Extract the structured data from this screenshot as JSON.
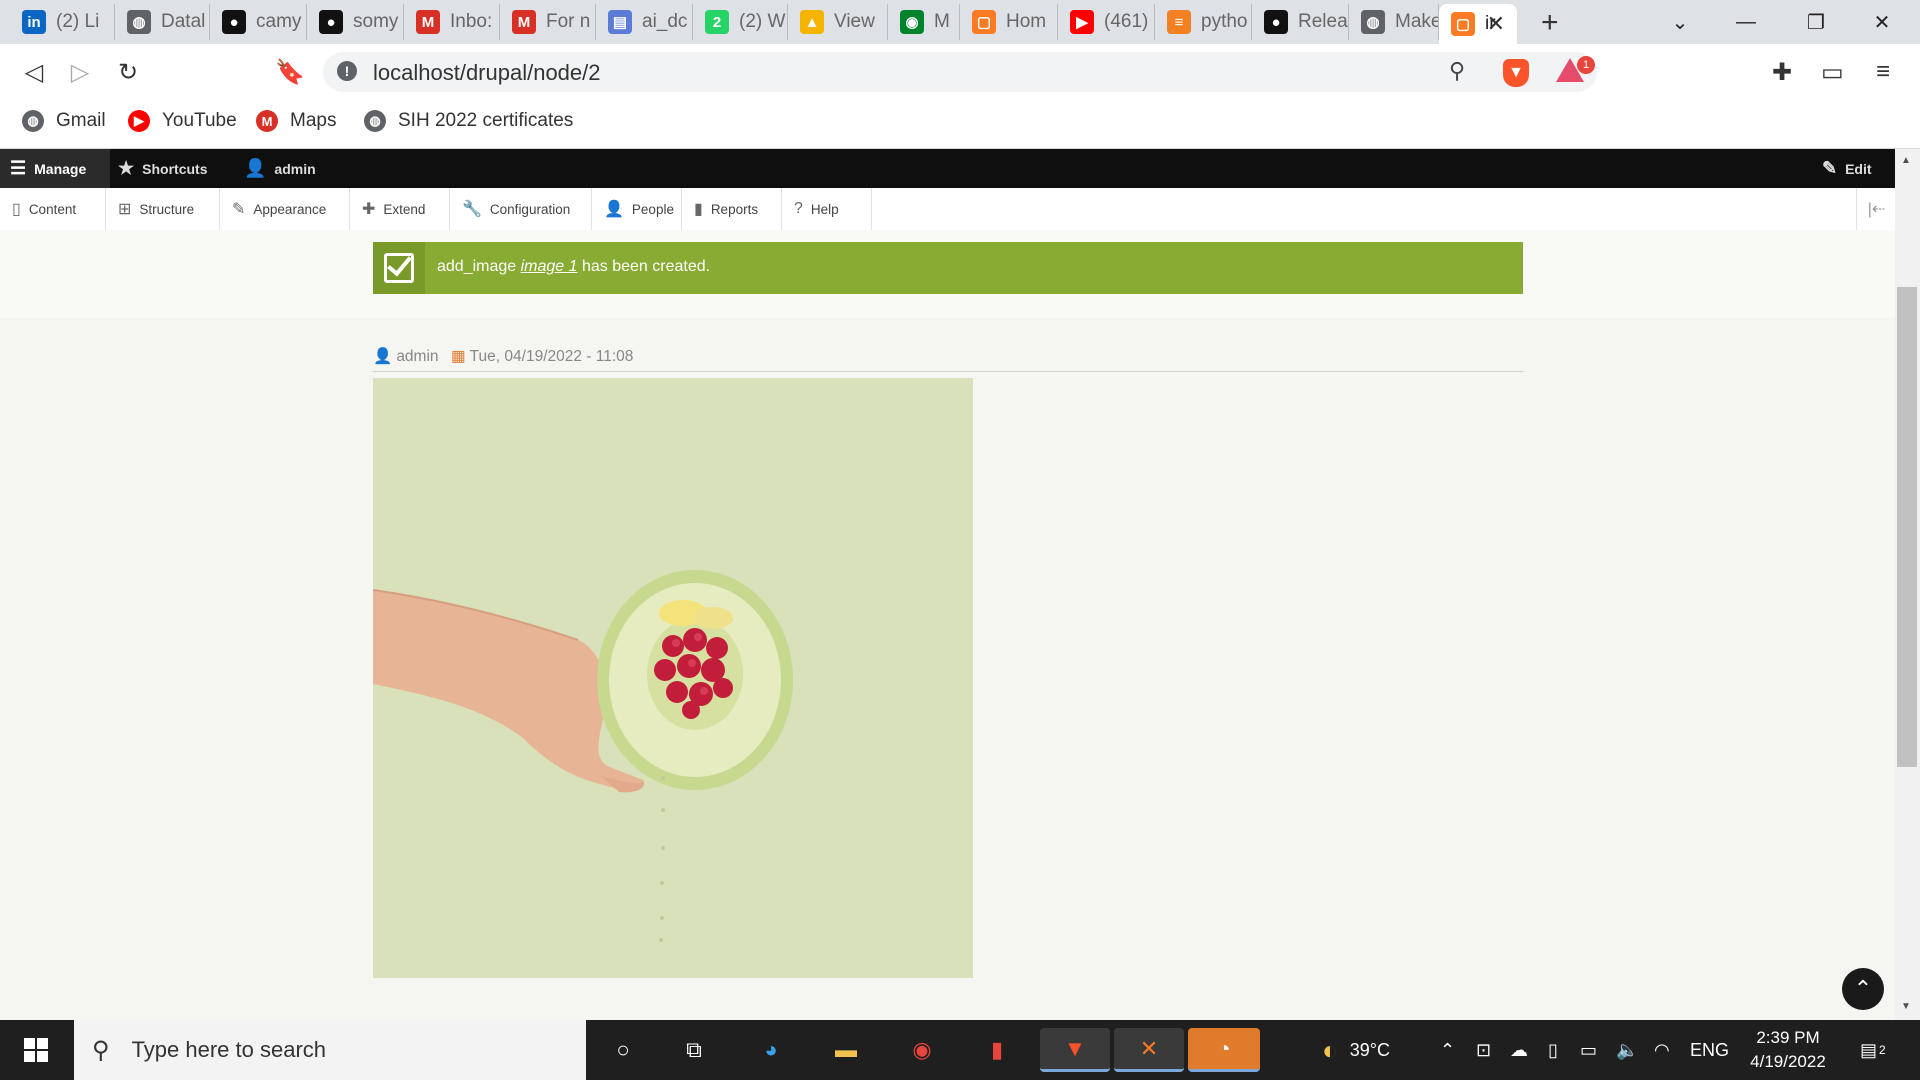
{
  "browser": {
    "tabs": [
      {
        "label": "(2) Li",
        "icon": "linkedin-icon",
        "color": "#0a66c2",
        "glyph": "in"
      },
      {
        "label": "Datal",
        "icon": "globe-icon",
        "color": "#5f6368",
        "glyph": "◍"
      },
      {
        "label": "camy",
        "icon": "github-icon",
        "color": "#111111",
        "glyph": "●"
      },
      {
        "label": "somy",
        "icon": "github-icon",
        "color": "#111111",
        "glyph": "●"
      },
      {
        "label": "Inbo:",
        "icon": "gmail-icon",
        "color": "#d93025",
        "glyph": "M"
      },
      {
        "label": "For n",
        "icon": "gmail-icon",
        "color": "#d93025",
        "glyph": "M"
      },
      {
        "label": "ai_dc",
        "icon": "sheet-icon",
        "color": "#5b7bd5",
        "glyph": "▤"
      },
      {
        "label": "(2) W",
        "icon": "whatsapp-icon",
        "color": "#25d366",
        "glyph": "2"
      },
      {
        "label": "View",
        "icon": "drive-icon",
        "color": "#f4b400",
        "glyph": "▲"
      },
      {
        "label": "M",
        "icon": "meet-icon",
        "color": "#00832d",
        "glyph": "◉"
      },
      {
        "label": "Hom",
        "icon": "xampp-icon",
        "color": "#fb7a24",
        "glyph": "▢"
      },
      {
        "label": "(461)",
        "icon": "youtube-icon",
        "color": "#ff0000",
        "glyph": "▶"
      },
      {
        "label": "pytho",
        "icon": "stackoverflow-icon",
        "color": "#f48024",
        "glyph": "≡"
      },
      {
        "label": "Relea",
        "icon": "github-icon",
        "color": "#111111",
        "glyph": "●"
      },
      {
        "label": "Make",
        "icon": "globe-icon",
        "color": "#5f6368",
        "glyph": "◍"
      },
      {
        "label": "ir",
        "icon": "xampp-icon",
        "color": "#fb7a24",
        "glyph": "▢"
      }
    ],
    "new_tab_glyph": "+",
    "url": "localhost/drupal/node/2",
    "rewards_count": "1"
  },
  "bookmarks": [
    {
      "label": "Gmail",
      "icon": "globe-icon",
      "color": "#5f6368",
      "glyph": "◍"
    },
    {
      "label": "YouTube",
      "icon": "youtube-icon",
      "color": "#ff0000",
      "glyph": "▶"
    },
    {
      "label": "Maps",
      "icon": "gmail-icon",
      "color": "#d93025",
      "glyph": "M"
    },
    {
      "label": "SIH 2022 certificates",
      "icon": "globe-icon",
      "color": "#5f6368",
      "glyph": "◍"
    }
  ],
  "admin_toolbar": {
    "manage": "Manage",
    "shortcuts": "Shortcuts",
    "user": "admin",
    "edit": "Edit",
    "tray": [
      {
        "label": "Content",
        "icon": "file-icon",
        "glyph": "▯"
      },
      {
        "label": "Structure",
        "icon": "sitemap-icon",
        "glyph": "⊞"
      },
      {
        "label": "Appearance",
        "icon": "brush-icon",
        "glyph": "✎"
      },
      {
        "label": "Extend",
        "icon": "puzzle-icon",
        "glyph": "✚"
      },
      {
        "label": "Configuration",
        "icon": "wrench-icon",
        "glyph": "🔧"
      },
      {
        "label": "People",
        "icon": "people-icon",
        "glyph": "👤"
      },
      {
        "label": "Reports",
        "icon": "chart-icon",
        "glyph": "▮"
      },
      {
        "label": "Help",
        "icon": "help-icon",
        "glyph": "?"
      }
    ]
  },
  "status_message": {
    "prefix": "add_image ",
    "link": "image 1",
    "suffix": " has been created.",
    "color": "#88ab33"
  },
  "node": {
    "author": "admin",
    "date": "Tue, 04/19/2022 - 11:08"
  },
  "taskbar": {
    "search_placeholder": "Type here to search",
    "weather": "39°C",
    "language": "ENG",
    "time": "2:39 PM",
    "date": "4/19/2022",
    "notifications": "2"
  }
}
